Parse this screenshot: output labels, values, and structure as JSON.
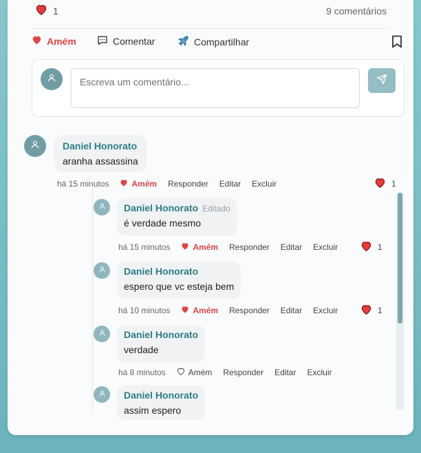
{
  "post": {
    "like_count": "1",
    "comments_count": "9 comentários"
  },
  "actions": {
    "amen": "Amém",
    "comment": "Comentar",
    "share": "Compartilhar"
  },
  "composer": {
    "placeholder": "Escreva um comentário..."
  },
  "comments": [
    {
      "author": "Daniel Honorato",
      "text": "aranha assassina",
      "time": "há 15 minutos",
      "amen": "Amém",
      "reply": "Responder",
      "edit": "Editar",
      "delete": "Excluir",
      "likes": "1"
    }
  ],
  "replies": [
    {
      "author": "Daniel Honorato",
      "edited": "Editado",
      "text": "é verdade mesmo",
      "time": "há 15 minutos",
      "amen": "Amém",
      "reply": "Responder",
      "edit": "Editar",
      "delete": "Excluir",
      "likes": "1"
    },
    {
      "author": "Daniel Honorato",
      "text": "espero que vc esteja bem",
      "time": "há 10 minutos",
      "amen": "Amém",
      "reply": "Responder",
      "edit": "Editar",
      "delete": "Excluir",
      "likes": "1"
    },
    {
      "author": "Daniel Honorato",
      "text": "verdade",
      "time": "há 8 minutos",
      "amen": "Amém",
      "reply": "Responder",
      "edit": "Editar",
      "delete": "Excluir"
    },
    {
      "author": "Daniel Honorato",
      "text": "assim espero"
    }
  ],
  "colors": {
    "accent": "#2d7d86",
    "amen_red": "#e04545",
    "background": "#7cbfc5"
  },
  "icons": [
    "heart-icon",
    "chat-icon",
    "plane-icon",
    "bookmark-icon",
    "user-icon",
    "send-icon",
    "heart-outline-icon"
  ]
}
